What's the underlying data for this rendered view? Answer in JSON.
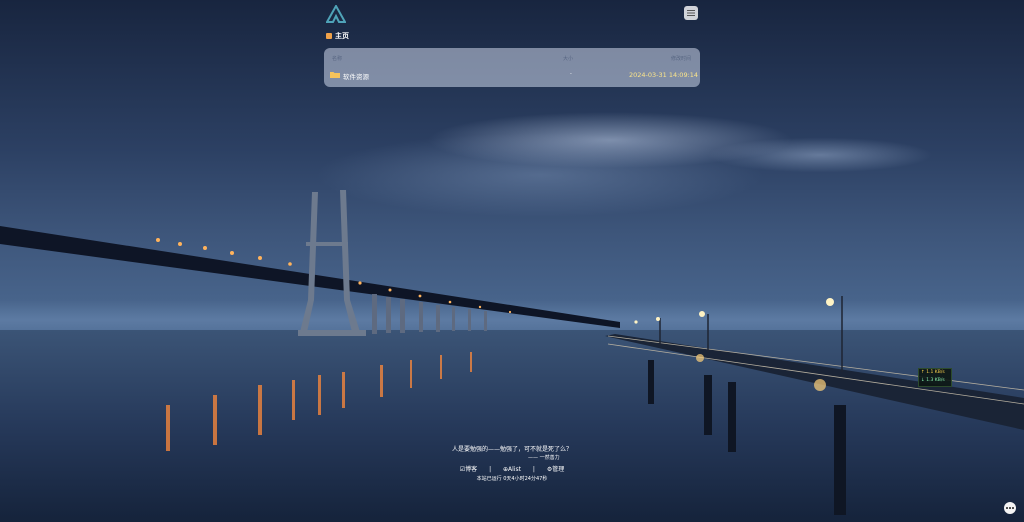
{
  "header": {
    "logo_icon": "alist-logo",
    "menu_icon": "list-menu-icon",
    "breadcrumb": {
      "home_icon": "home-icon",
      "label": "主页"
    }
  },
  "file_list": {
    "columns": {
      "name": "名称",
      "size": "大小",
      "modified": "修改时间"
    },
    "rows": [
      {
        "icon": "folder-icon",
        "name": "软件资源",
        "size": "-",
        "modified": "2024-03-31 14:09:14"
      }
    ]
  },
  "footer": {
    "quote": "人是要勉强的——勉强了，可不就是死了么？",
    "quote_author": "—— 一然善力",
    "links": {
      "blog": "☑博客",
      "alist": "⊕Alist",
      "manage": "⚙管理",
      "separator": "|"
    },
    "uptime": "本站已运行 0天4小时24分47秒"
  },
  "net_speed": {
    "up": "↑ 1.1 KB/s",
    "down": "↓ 1.3 KB/s"
  },
  "colors": {
    "accent": "#4fa3b8",
    "panel_bg": "#cdd7eb",
    "folder": "#f6c35b",
    "date_text": "#fde68a"
  }
}
